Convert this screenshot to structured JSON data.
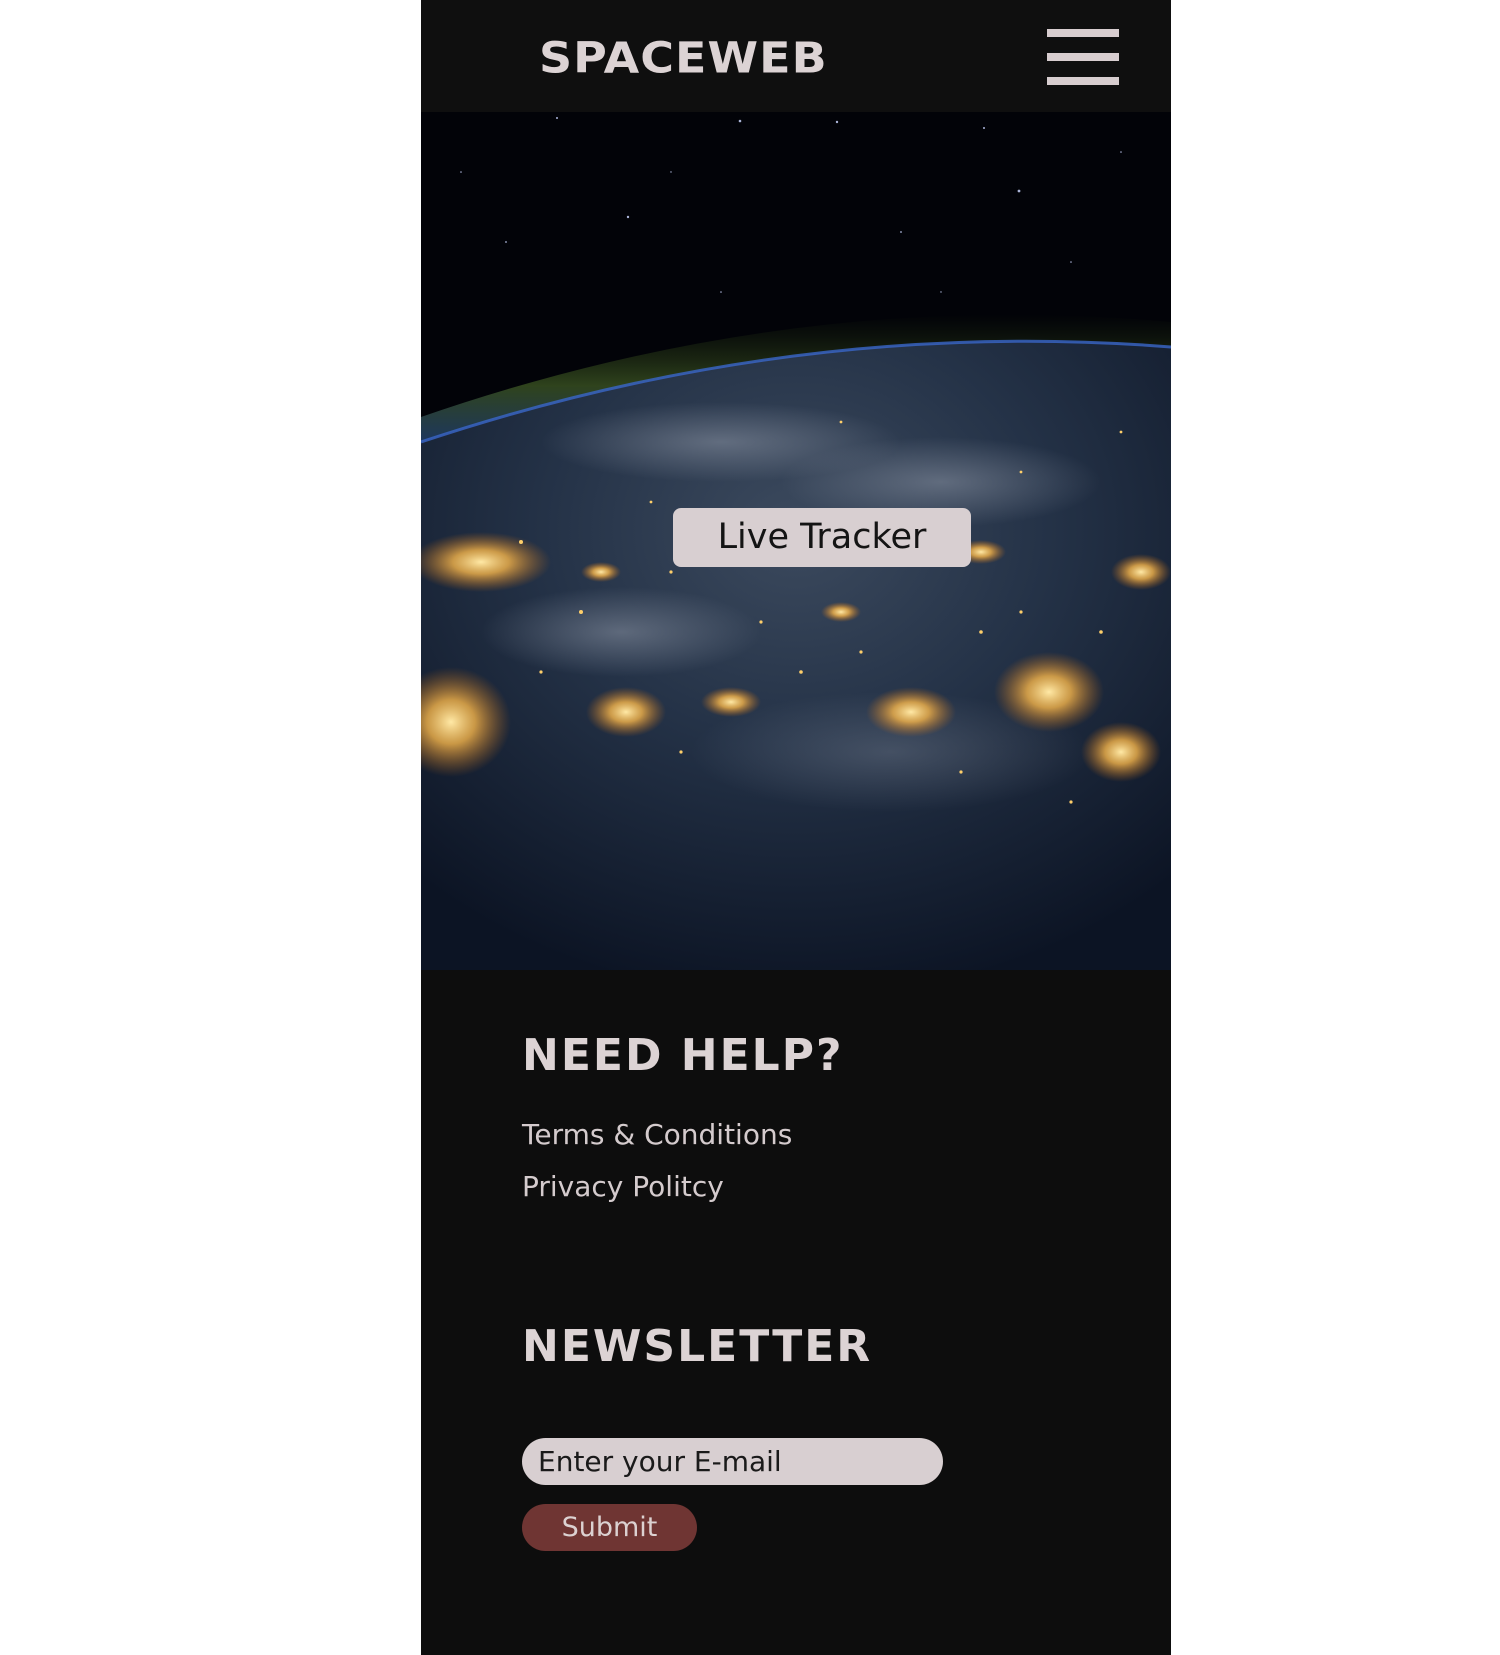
{
  "header": {
    "logo": "SPACEWEB",
    "menu_icon": "hamburger-menu-icon"
  },
  "hero": {
    "image": "earth-at-night-from-space",
    "button_label": "Live Tracker"
  },
  "help": {
    "title": "NEED HELP?",
    "links": [
      "Terms & Conditions",
      "Privacy Politcy"
    ]
  },
  "newsletter": {
    "title": "NEWSLETTER",
    "placeholder": "Enter your E-mail",
    "submit_label": "Submit"
  },
  "colors": {
    "background": "#0d0d0d",
    "text_light": "#dcd3d4",
    "button_light": "#d8cfd1",
    "submit": "#6f3533"
  }
}
